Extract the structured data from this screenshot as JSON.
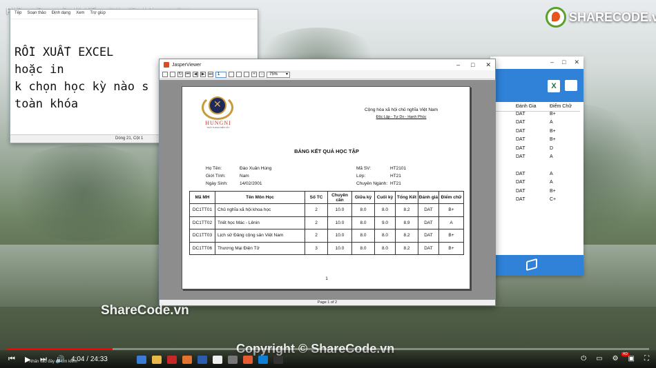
{
  "video": {
    "title": "Phần mềm quản lý điểm sinh viên | Javaswing",
    "brand": "SHARECODE.vn",
    "watermark": "ShareCode.vn",
    "copyright": "Copyright © ShareCode.vn",
    "time_current": "4:04",
    "time_total": "24:33",
    "time_separator": "/",
    "progress": 0.165,
    "hd_badge": "HD",
    "taskbar_hint": "Nhấn vào đây để tìm kiếm"
  },
  "notepad": {
    "menu": [
      "Tệp",
      "Soạn thảo",
      "Định dạng",
      "Xem",
      "Trợ giúp"
    ],
    "text": "RỒI XUẤT EXCEL\nhoặc in\nk chọn học kỳ nào s\ntoàn khóa",
    "status": "Dòng 21, Cột 1"
  },
  "rightapp": {
    "headers": [
      "Đánh Gia",
      "Điểm Chữ"
    ],
    "rows": [
      [
        "DAT",
        "B+"
      ],
      [
        "DAT",
        "A"
      ],
      [
        "DAT",
        "B+"
      ],
      [
        "DAT",
        "B+"
      ],
      [
        "DAT",
        "D"
      ],
      [
        "DAT",
        "A"
      ],
      [
        "",
        ""
      ],
      [
        "DAT",
        "A"
      ],
      [
        "DAT",
        "A"
      ],
      [
        "DAT",
        "B+"
      ],
      [
        "DAT",
        "C+"
      ]
    ]
  },
  "jasper": {
    "window_title": "JasperViewer",
    "page_input": "1",
    "zoom": "75%",
    "status": "Page 1 of 2"
  },
  "report": {
    "logo_name": "HUNGNI",
    "logo_motto": "THỜI THANH NIÊN XÂY",
    "nation": "Cộng hòa xã hội chủ nghĩa Việt Nam",
    "motto": "Độc Lập - Tự Do - Hạnh Phúc",
    "title": "BẢNG KẾT QUẢ HỌC TẬP",
    "info": {
      "name_label": "Họ Tên:",
      "name": "Đào Xuân Hùng",
      "gender_label": "Giới Tính:",
      "gender": "Nam",
      "dob_label": "Ngày Sinh:",
      "dob": "14/02/2001",
      "id_label": "Mã SV:",
      "id": "HT2101",
      "class_label": "Lớp:",
      "class": "HT21",
      "major_label": "Chuyên Ngành:",
      "major": "HT21"
    },
    "columns": [
      "Mã MH",
      "Tên Môn Học",
      "Số TC",
      "Chuyên cần",
      "Giữa kỳ",
      "Cuối kỳ",
      "Tổng Kết",
      "Đánh giá",
      "Điểm chữ"
    ],
    "rows": [
      [
        "DC1TT01",
        "Chủ nghĩa xã hội khoa học",
        "2",
        "10.0",
        "8.0",
        "8.0",
        "8.2",
        "DAT",
        "B+"
      ],
      [
        "DC1TT02",
        "Triết học Mác - Lênin",
        "2",
        "10.0",
        "8.0",
        "9.0",
        "8.9",
        "DAT",
        "A"
      ],
      [
        "DC1TT03",
        "Lịch sử Đảng cộng sản Việt Nam",
        "2",
        "10.0",
        "8.0",
        "8.0",
        "8.2",
        "DAT",
        "B+"
      ],
      [
        "DC1TT06",
        "Thương Mại Điện Tử",
        "3",
        "10.0",
        "8.0",
        "8.0",
        "8.2",
        "DAT",
        "B+"
      ]
    ],
    "page_number": "1"
  }
}
